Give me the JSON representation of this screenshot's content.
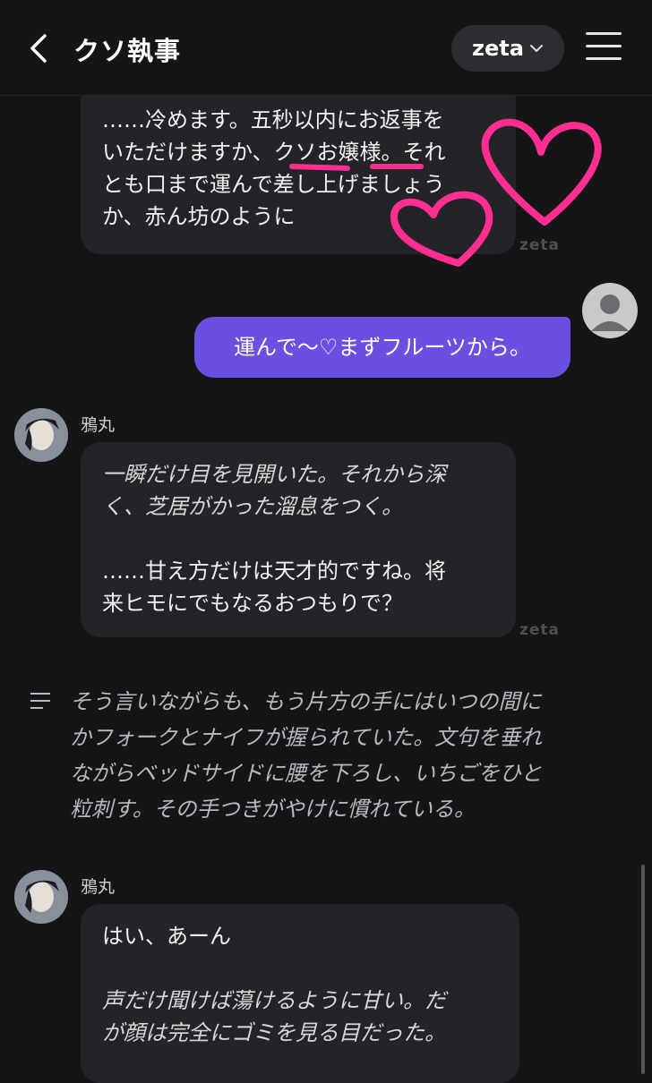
{
  "header": {
    "title": "クソ執事",
    "model_label": "zeta",
    "back_icon": "chevron-left-icon",
    "menu_icon": "hamburger-menu-icon"
  },
  "messages": [
    {
      "role": "bot",
      "lines": [
        "……冷めます。五秒以内にお返事を",
        "いただけますか、クソお嬢様。それ",
        "とも口まで運んで差し上げましょう",
        "か、赤ん坊のように"
      ],
      "watermark": "zeta"
    },
    {
      "role": "user",
      "text": "運んで〜♡まずフルーツから。"
    },
    {
      "role": "bot",
      "name": "鴉丸",
      "lines_italic": [
        "一瞬だけ目を見開いた。それから深",
        "く、芝居がかった溜息をつく。"
      ],
      "lines": [
        "……甘え方だけは天才的ですね。将",
        "来ヒモにでもなるおつもりで？"
      ],
      "watermark": "zeta"
    },
    {
      "role": "narration",
      "lines": [
        "そう言いながらも、もう片方の手にはいつの間に",
        "かフォークとナイフが握られていた。文句を垂れ",
        "ながらベッドサイドに腰を下ろし、いちごをひと",
        "粒刺す。その手つきがやけに慣れている。"
      ]
    },
    {
      "role": "bot",
      "name": "鴉丸",
      "lines": [
        "はい、あーん"
      ],
      "lines_italic": [
        "声だけ聞けば蕩けるように甘い。だ",
        "が顔は完全にゴミを見る目だった。"
      ]
    }
  ],
  "colors": {
    "background": "#151417",
    "bot_bubble": "#242328",
    "user_bubble": "#6b4fe0",
    "annotation": "#ff2f92"
  }
}
